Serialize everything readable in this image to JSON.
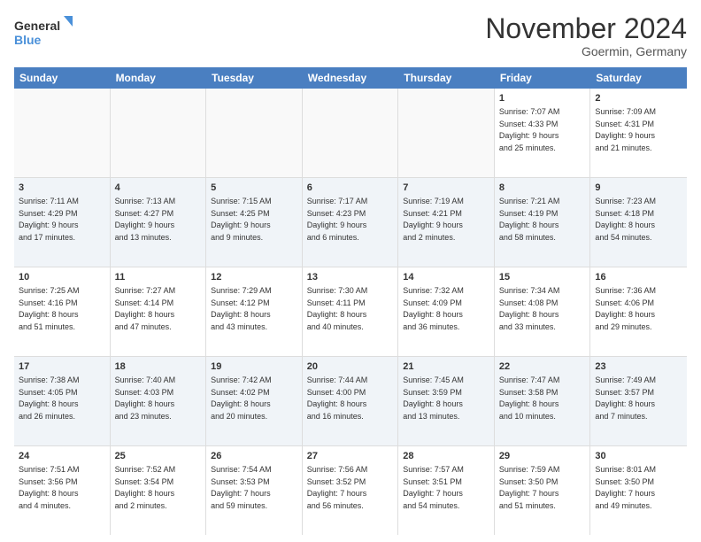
{
  "logo": {
    "line1": "General",
    "line2": "Blue"
  },
  "title": "November 2024",
  "location": "Goermin, Germany",
  "header_days": [
    "Sunday",
    "Monday",
    "Tuesday",
    "Wednesday",
    "Thursday",
    "Friday",
    "Saturday"
  ],
  "weeks": [
    [
      {
        "day": "",
        "info": ""
      },
      {
        "day": "",
        "info": ""
      },
      {
        "day": "",
        "info": ""
      },
      {
        "day": "",
        "info": ""
      },
      {
        "day": "",
        "info": ""
      },
      {
        "day": "1",
        "info": "Sunrise: 7:07 AM\nSunset: 4:33 PM\nDaylight: 9 hours\nand 25 minutes."
      },
      {
        "day": "2",
        "info": "Sunrise: 7:09 AM\nSunset: 4:31 PM\nDaylight: 9 hours\nand 21 minutes."
      }
    ],
    [
      {
        "day": "3",
        "info": "Sunrise: 7:11 AM\nSunset: 4:29 PM\nDaylight: 9 hours\nand 17 minutes."
      },
      {
        "day": "4",
        "info": "Sunrise: 7:13 AM\nSunset: 4:27 PM\nDaylight: 9 hours\nand 13 minutes."
      },
      {
        "day": "5",
        "info": "Sunrise: 7:15 AM\nSunset: 4:25 PM\nDaylight: 9 hours\nand 9 minutes."
      },
      {
        "day": "6",
        "info": "Sunrise: 7:17 AM\nSunset: 4:23 PM\nDaylight: 9 hours\nand 6 minutes."
      },
      {
        "day": "7",
        "info": "Sunrise: 7:19 AM\nSunset: 4:21 PM\nDaylight: 9 hours\nand 2 minutes."
      },
      {
        "day": "8",
        "info": "Sunrise: 7:21 AM\nSunset: 4:19 PM\nDaylight: 8 hours\nand 58 minutes."
      },
      {
        "day": "9",
        "info": "Sunrise: 7:23 AM\nSunset: 4:18 PM\nDaylight: 8 hours\nand 54 minutes."
      }
    ],
    [
      {
        "day": "10",
        "info": "Sunrise: 7:25 AM\nSunset: 4:16 PM\nDaylight: 8 hours\nand 51 minutes."
      },
      {
        "day": "11",
        "info": "Sunrise: 7:27 AM\nSunset: 4:14 PM\nDaylight: 8 hours\nand 47 minutes."
      },
      {
        "day": "12",
        "info": "Sunrise: 7:29 AM\nSunset: 4:12 PM\nDaylight: 8 hours\nand 43 minutes."
      },
      {
        "day": "13",
        "info": "Sunrise: 7:30 AM\nSunset: 4:11 PM\nDaylight: 8 hours\nand 40 minutes."
      },
      {
        "day": "14",
        "info": "Sunrise: 7:32 AM\nSunset: 4:09 PM\nDaylight: 8 hours\nand 36 minutes."
      },
      {
        "day": "15",
        "info": "Sunrise: 7:34 AM\nSunset: 4:08 PM\nDaylight: 8 hours\nand 33 minutes."
      },
      {
        "day": "16",
        "info": "Sunrise: 7:36 AM\nSunset: 4:06 PM\nDaylight: 8 hours\nand 29 minutes."
      }
    ],
    [
      {
        "day": "17",
        "info": "Sunrise: 7:38 AM\nSunset: 4:05 PM\nDaylight: 8 hours\nand 26 minutes."
      },
      {
        "day": "18",
        "info": "Sunrise: 7:40 AM\nSunset: 4:03 PM\nDaylight: 8 hours\nand 23 minutes."
      },
      {
        "day": "19",
        "info": "Sunrise: 7:42 AM\nSunset: 4:02 PM\nDaylight: 8 hours\nand 20 minutes."
      },
      {
        "day": "20",
        "info": "Sunrise: 7:44 AM\nSunset: 4:00 PM\nDaylight: 8 hours\nand 16 minutes."
      },
      {
        "day": "21",
        "info": "Sunrise: 7:45 AM\nSunset: 3:59 PM\nDaylight: 8 hours\nand 13 minutes."
      },
      {
        "day": "22",
        "info": "Sunrise: 7:47 AM\nSunset: 3:58 PM\nDaylight: 8 hours\nand 10 minutes."
      },
      {
        "day": "23",
        "info": "Sunrise: 7:49 AM\nSunset: 3:57 PM\nDaylight: 8 hours\nand 7 minutes."
      }
    ],
    [
      {
        "day": "24",
        "info": "Sunrise: 7:51 AM\nSunset: 3:56 PM\nDaylight: 8 hours\nand 4 minutes."
      },
      {
        "day": "25",
        "info": "Sunrise: 7:52 AM\nSunset: 3:54 PM\nDaylight: 8 hours\nand 2 minutes."
      },
      {
        "day": "26",
        "info": "Sunrise: 7:54 AM\nSunset: 3:53 PM\nDaylight: 7 hours\nand 59 minutes."
      },
      {
        "day": "27",
        "info": "Sunrise: 7:56 AM\nSunset: 3:52 PM\nDaylight: 7 hours\nand 56 minutes."
      },
      {
        "day": "28",
        "info": "Sunrise: 7:57 AM\nSunset: 3:51 PM\nDaylight: 7 hours\nand 54 minutes."
      },
      {
        "day": "29",
        "info": "Sunrise: 7:59 AM\nSunset: 3:50 PM\nDaylight: 7 hours\nand 51 minutes."
      },
      {
        "day": "30",
        "info": "Sunrise: 8:01 AM\nSunset: 3:50 PM\nDaylight: 7 hours\nand 49 minutes."
      }
    ]
  ]
}
